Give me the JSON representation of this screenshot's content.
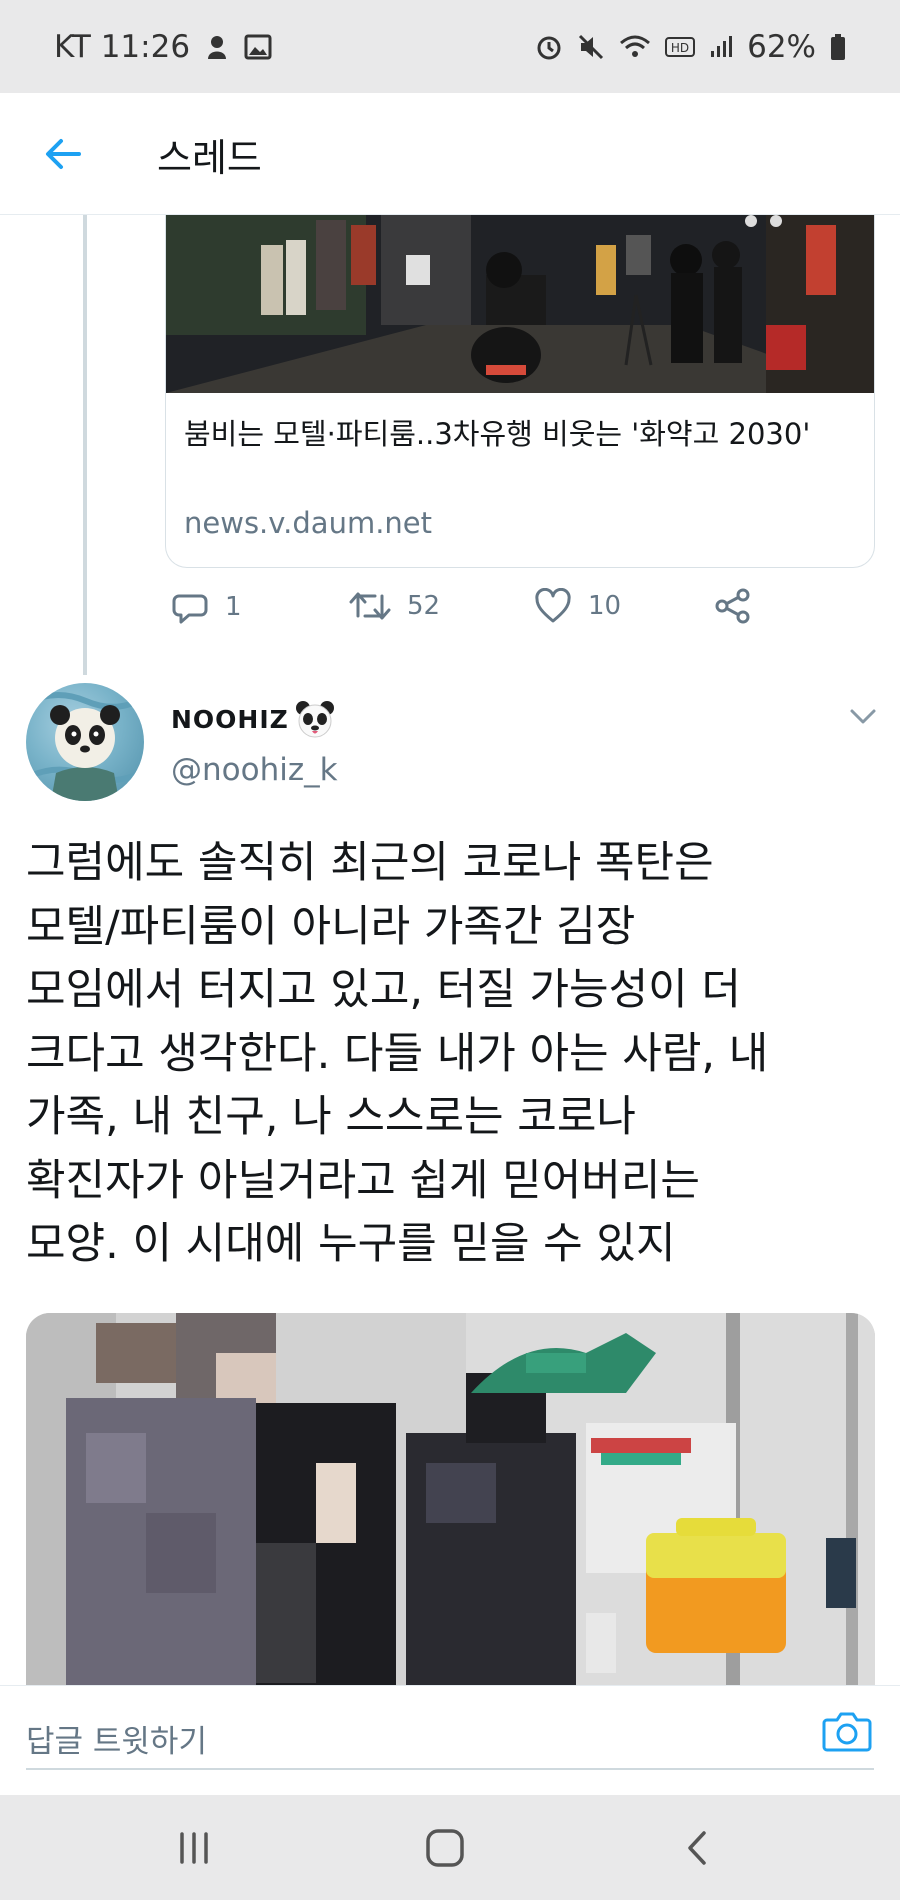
{
  "status_bar": {
    "carrier_time": "KT 11:26",
    "battery": "62%"
  },
  "app_bar": {
    "title": "스레드"
  },
  "link_card": {
    "title": "붐비는 모텔·파티룸..3차유행 비웃는 '화약고 2030'",
    "domain": "news.v.daum.net"
  },
  "actions": {
    "reply_count": "1",
    "retweet_count": "52",
    "like_count": "10"
  },
  "tweet": {
    "display_name": "NOOHIZ",
    "handle": "@noohiz_k",
    "text": "그럼에도 솔직히 최근의 코로나 폭탄은\n모텔/파티룸이 아니라 가족간 김장\n모임에서 터지고 있고, 터질 가능성이 더\n크다고 생각한다. 다들 내가 아는 사람, 내\n가족, 내 친구, 나 스스로는 코로나\n확진자가 아닐거라고 쉽게 믿어버리는\n모양. 이 시대에 누구를 믿을 수 있지"
  },
  "reply_bar": {
    "placeholder": "답글 트윗하기"
  },
  "colors": {
    "accent": "#1da1f2",
    "secondary_text": "#657786",
    "status_bar_bg": "#e9e9ea"
  },
  "icons": {
    "back": "arrow-left-icon",
    "reply": "speech-bubble-icon",
    "retweet": "retweet-icon",
    "like": "heart-icon",
    "share": "share-icon",
    "caret": "chevron-down-icon",
    "camera": "camera-icon"
  }
}
